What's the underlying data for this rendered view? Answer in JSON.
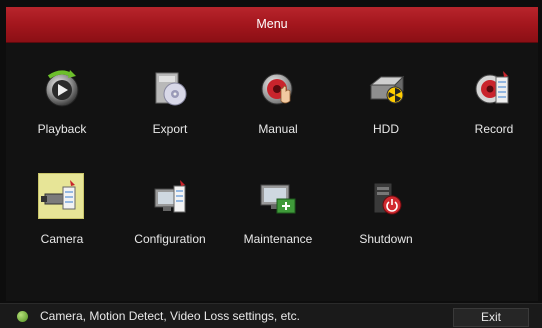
{
  "window": {
    "title": "Menu"
  },
  "menu": {
    "items": [
      {
        "label": "Playback",
        "icon": "playback-icon",
        "selected": false
      },
      {
        "label": "Export",
        "icon": "export-icon",
        "selected": false
      },
      {
        "label": "Manual",
        "icon": "manual-icon",
        "selected": false
      },
      {
        "label": "HDD",
        "icon": "hdd-icon",
        "selected": false
      },
      {
        "label": "Record",
        "icon": "record-icon",
        "selected": false
      },
      {
        "label": "Camera",
        "icon": "camera-icon",
        "selected": true
      },
      {
        "label": "Configuration",
        "icon": "configuration-icon",
        "selected": false
      },
      {
        "label": "Maintenance",
        "icon": "maintenance-icon",
        "selected": false
      },
      {
        "label": "Shutdown",
        "icon": "shutdown-icon",
        "selected": false
      }
    ]
  },
  "status": {
    "hint": "Camera, Motion Detect, Video Loss settings, etc.",
    "hint_icon": "info-icon",
    "exit_label": "Exit"
  },
  "colors": {
    "titlebar": "#a3161d",
    "selection": "#e7e597",
    "background": "#121212"
  }
}
